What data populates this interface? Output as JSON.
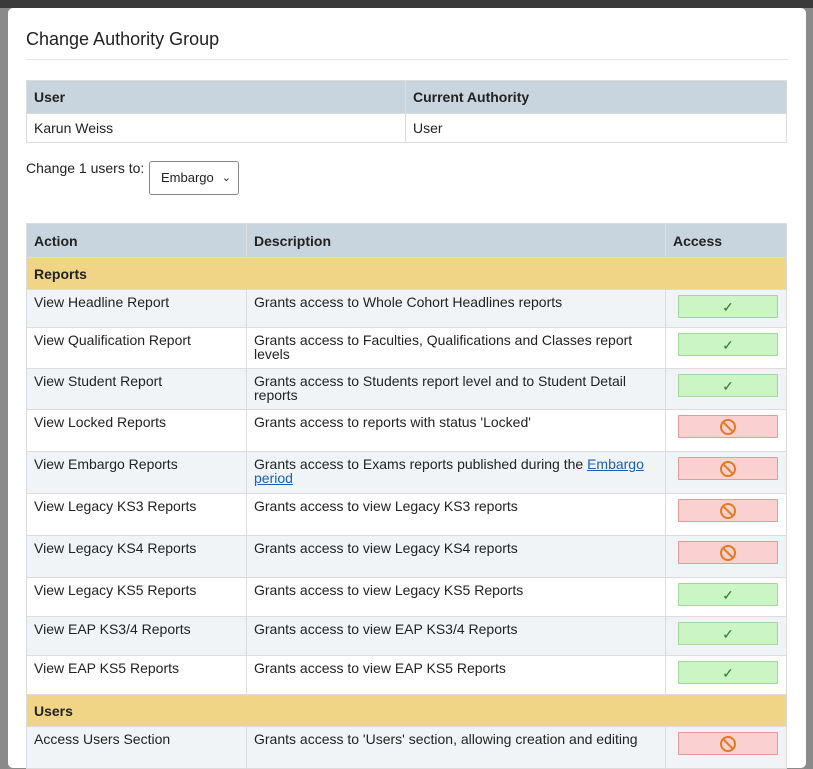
{
  "modal": {
    "title": "Change Authority Group"
  },
  "user_table": {
    "headers": [
      "User",
      "Current Authority"
    ],
    "rows": [
      {
        "user": "Karun Weiss",
        "authority": "User"
      }
    ]
  },
  "change": {
    "label": "Change 1 users to:",
    "selected": "Embargo"
  },
  "authority_table": {
    "headers": [
      "Action",
      "Description",
      "Access"
    ],
    "groups": [
      {
        "name": "Reports",
        "rows": [
          {
            "action": "View Headline Report",
            "description": "Grants access to Whole Cohort Headlines reports",
            "access": "allowed"
          },
          {
            "action": "View Qualification Report",
            "description": "Grants access to Faculties, Qualifications and Classes report levels",
            "access": "allowed"
          },
          {
            "action": "View Student Report",
            "description": "Grants access to Students report level and to Student Detail reports",
            "access": "allowed"
          },
          {
            "action": "View Locked Reports",
            "description": "Grants access to reports with status 'Locked'",
            "access": "denied"
          },
          {
            "action": "View Embargo Reports",
            "description": "Grants access to Exams reports published during the",
            "link": "Embargo period",
            "access": "denied"
          },
          {
            "action": "View Legacy KS3 Reports",
            "description": "Grants access to view Legacy KS3 reports",
            "access": "denied"
          },
          {
            "action": "View Legacy KS4 Reports",
            "description": "Grants access to view Legacy KS4 reports",
            "access": "denied"
          },
          {
            "action": "View Legacy KS5 Reports",
            "description": "Grants access to view Legacy KS5 Reports",
            "access": "allowed"
          },
          {
            "action": "View EAP KS3/4 Reports",
            "description": "Grants access to view EAP KS3/4 Reports",
            "access": "allowed"
          },
          {
            "action": "View EAP KS5 Reports",
            "description": "Grants access to view EAP KS5 Reports",
            "access": "allowed"
          }
        ]
      },
      {
        "name": "Users",
        "rows": [
          {
            "action": "Access Users Section",
            "description": "Grants access to 'Users' section, allowing creation and editing",
            "access": "denied"
          }
        ]
      }
    ]
  },
  "icons": {
    "allowed": "check-icon",
    "denied": "prohibited-icon"
  },
  "colors": {
    "header_bg": "#c8d4de",
    "group_bg": "#f0d586",
    "allow_bg": "#ccf5c5",
    "deny_bg": "#fbd0d0",
    "deny_icon": "#e37a20"
  }
}
